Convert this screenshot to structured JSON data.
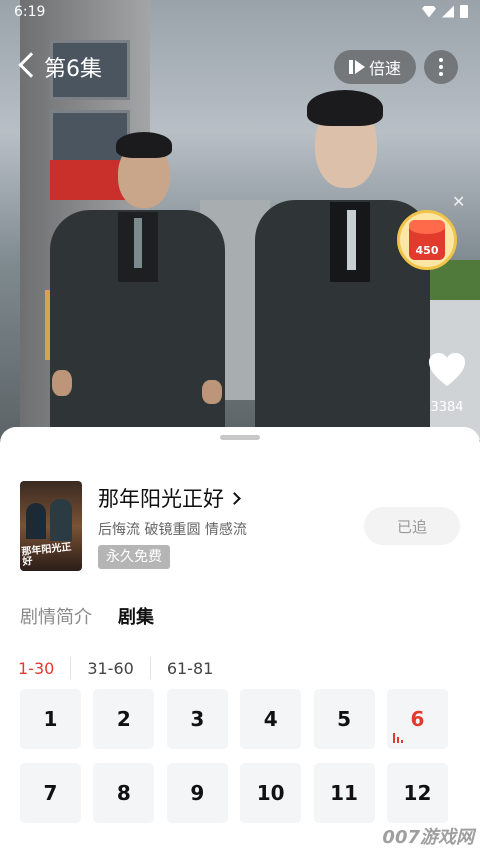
{
  "status_bar": {
    "time": "6:19"
  },
  "player": {
    "episode_title": "第6集",
    "speed_label": "倍速",
    "reward_amount": "450",
    "like_count": "3384"
  },
  "drama": {
    "title": "那年阳光正好",
    "tags": "后悔流 破镜重圆 情感流",
    "free_badge": "永久免费",
    "follow_label": "已追",
    "poster_text": "那年阳光正好"
  },
  "tabs": [
    {
      "label": "剧情简介",
      "active": false
    },
    {
      "label": "剧集",
      "active": true
    }
  ],
  "ranges": [
    {
      "label": "1-30",
      "active": true
    },
    {
      "label": "31-60",
      "active": false
    },
    {
      "label": "61-81",
      "active": false
    }
  ],
  "episodes": [
    "1",
    "2",
    "3",
    "4",
    "5",
    "6",
    "7",
    "8",
    "9",
    "10",
    "11",
    "12"
  ],
  "current_episode": "6",
  "watermark": "007游戏网",
  "colors": {
    "accent": "#e33a2e",
    "sheet_bg": "#ffffff",
    "episode_bg": "#f4f5f7"
  }
}
